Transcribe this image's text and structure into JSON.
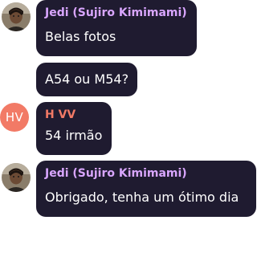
{
  "colors": {
    "bubble_bg": "#1f1b30",
    "jedi_name": "#d9a6ff",
    "hv_accent": "#f27a66",
    "text": "#ffffff"
  },
  "messages": [
    {
      "sender": "Jedi (Sujiro Kimimami)",
      "avatar": "user-photo-avatar",
      "text": "Belas fotos"
    },
    {
      "sender": "",
      "avatar": "",
      "text": "A54 ou M54?"
    },
    {
      "sender": "H VV",
      "avatar": "HV",
      "text": "54 irmão"
    },
    {
      "sender": "Jedi (Sujiro Kimimami)",
      "avatar": "user-photo-avatar",
      "text": "Obrigado, tenha um ótimo dia"
    }
  ]
}
